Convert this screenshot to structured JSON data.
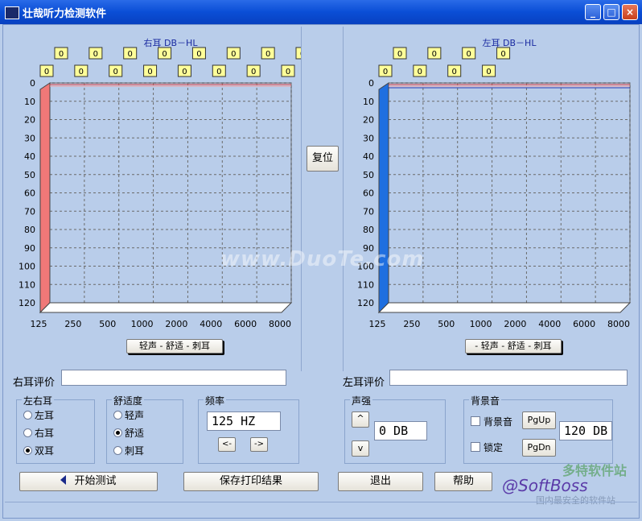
{
  "window": {
    "title": "壮哉听力检测软件",
    "minimize": "_",
    "maximize": "□",
    "close": "×"
  },
  "right_chart": {
    "title": "右耳 DB－HL",
    "legend": "轻声 - 舒适 - 刺耳",
    "color": "#f07878"
  },
  "left_chart": {
    "title": "左耳 DB－HL",
    "legend": "- 轻声 - 舒适 - 刺耳",
    "color": "#1f6fe0"
  },
  "chart_data": [
    {
      "type": "line",
      "title": "右耳 DB－HL",
      "x": [
        "125",
        "250",
        "500",
        "1000",
        "2000",
        "4000",
        "6000",
        "8000"
      ],
      "yticks": [
        "0",
        "10",
        "20",
        "30",
        "40",
        "50",
        "60",
        "70",
        "80",
        "90",
        "100",
        "110",
        "120"
      ],
      "ylim": [
        0,
        120
      ],
      "series": [
        {
          "name": "轻声",
          "values": [
            0,
            0,
            0,
            0,
            0,
            0,
            0,
            0
          ]
        },
        {
          "name": "舒适",
          "values": [
            0,
            0,
            0,
            0,
            0,
            0,
            0,
            0
          ]
        }
      ],
      "data_labels": [
        "0",
        "0",
        "0",
        "0",
        "0",
        "0",
        "0",
        "0",
        "0",
        "0",
        "0",
        "0",
        "0",
        "0",
        "0",
        "0"
      ],
      "legend": "轻声 - 舒适 - 刺耳"
    },
    {
      "type": "line",
      "title": "左耳 DB－HL",
      "x": [
        "125",
        "250",
        "500",
        "1000",
        "2000",
        "4000",
        "6000",
        "8000"
      ],
      "yticks": [
        "0",
        "10",
        "20",
        "30",
        "40",
        "50",
        "60",
        "70",
        "80",
        "90",
        "100",
        "110",
        "120"
      ],
      "ylim": [
        0,
        120
      ],
      "series": [
        {
          "name": "轻声",
          "values": [
            0,
            0,
            0,
            0,
            0,
            0,
            0,
            0
          ]
        },
        {
          "name": "舒适",
          "values": [
            0,
            0,
            0,
            0,
            0,
            0,
            0,
            0
          ]
        },
        {
          "name": "刺耳",
          "values": [
            0,
            0,
            0,
            0,
            0,
            0,
            0,
            0
          ]
        }
      ],
      "data_labels": [
        "0",
        "0",
        "0",
        "0",
        "0",
        "0",
        "0",
        "0"
      ],
      "legend": "- 轻声 - 舒适 - 刺耳"
    }
  ],
  "reset_button": "复位",
  "right_eval": {
    "label": "右耳评价",
    "value": ""
  },
  "left_eval": {
    "label": "左耳评价",
    "value": ""
  },
  "ear_group": {
    "title": "左右耳",
    "options": [
      "左耳",
      "右耳",
      "双耳"
    ],
    "selected": "双耳"
  },
  "comfort_group": {
    "title": "舒适度",
    "options": [
      "轻声",
      "舒适",
      "刺耳"
    ],
    "selected": "舒适"
  },
  "freq_group": {
    "title": "频率",
    "value": "125 HZ",
    "prev": "<-",
    "next": "->"
  },
  "volume_group": {
    "title": "声强",
    "value": "0 DB",
    "up": "^",
    "down": "v"
  },
  "bg_group": {
    "title": "背景音",
    "bg_check": "背景音",
    "lock_check": "锁定",
    "pgup": "PgUp",
    "pgdn": "PgDn",
    "value": "120 DB"
  },
  "buttons": {
    "start": "开始测试",
    "save": "保存打印结果",
    "exit": "退出",
    "help": "帮助"
  },
  "watermarks": {
    "center": "www.DuoTe.com",
    "logo": "@SoftBoss",
    "brand": "多特软件站",
    "brand_sub": "国内最安全的软件站"
  }
}
